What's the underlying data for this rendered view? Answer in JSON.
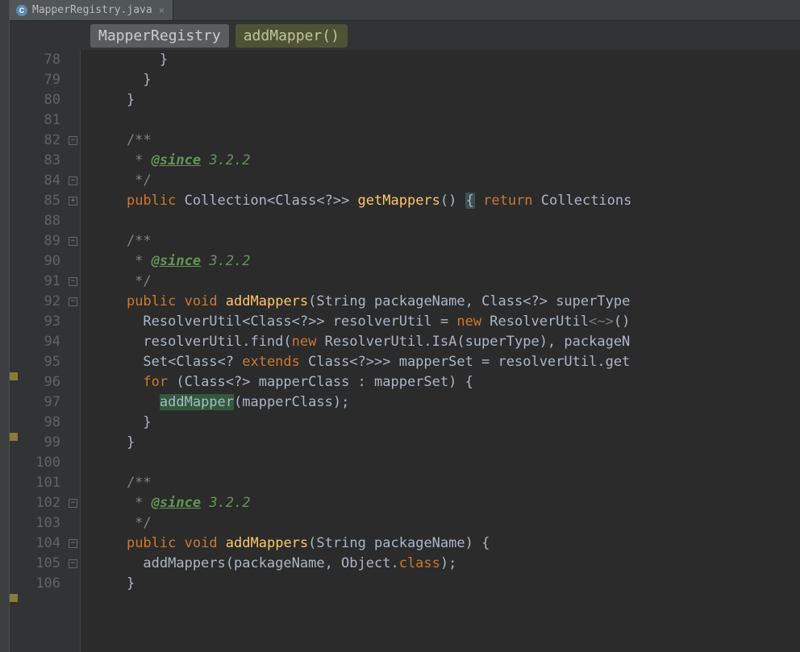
{
  "tab": {
    "filename": "MapperRegistry.java",
    "close_glyph": "×"
  },
  "breadcrumb": {
    "class": "MapperRegistry",
    "method": "addMapper()"
  },
  "lines": {
    "l78": "78",
    "l79": "79",
    "l80": "80",
    "l81": "81",
    "l82": "82",
    "l83": "83",
    "l84": "84",
    "l85": "85",
    "l88": "88",
    "l89": "89",
    "l90": "90",
    "l91": "91",
    "l92": "92",
    "l93": "93",
    "l94": "94",
    "l95": "95",
    "l96": "96",
    "l97": "97",
    "l98": "98",
    "l99": "99",
    "l100": "100",
    "l101": "101",
    "l102": "102",
    "l103": "103",
    "l104": "104",
    "l105": "105",
    "l106": "106"
  },
  "code": {
    "c78": "        }",
    "c79": "      }",
    "c80": "    }",
    "c81": "",
    "c82_open": "    /**",
    "c82_star": "     * ",
    "c82_tag": "@since",
    "c82_val": " 3.2.2",
    "c82_close": "     */",
    "c85_public": "public",
    "c85_sig1": " Collection<Class<?>> ",
    "c85_method": "getMappers",
    "c85_sig2": "() ",
    "c85_return": "return",
    "c85_tail": " Collections",
    "c88": "",
    "c92_public": "public",
    "c92_void": " void ",
    "c92_method": "addMappers",
    "c92_sig": "(String packageName, Class<?> superType",
    "c93_a": "      ResolverUtil<Class<?>> resolverUtil = ",
    "c93_new": "new",
    "c93_b": " ResolverUtil",
    "c93_diamond": "<~>",
    "c93_c": "()",
    "c94_a": "      resolverUtil.find(",
    "c94_new": "new",
    "c94_b": " ResolverUtil.IsA(superType), packageN",
    "c95_a": "      Set<Class<? ",
    "c95_ext": "extends",
    "c95_b": " Class<?>>> mapperSet = resolverUtil.get",
    "c96_for": "for",
    "c96_a": " (Class<?> mapperClass : mapperSet) {",
    "c97_call": "addMapper",
    "c97_tail": "(mapperClass);",
    "c98": "      }",
    "c99": "    }",
    "c100": "",
    "c104_public": "public",
    "c104_void": " void ",
    "c104_method": "addMappers",
    "c104_sig": "(String packageName) {",
    "c105_a": "      addMappers(packageName, Object.",
    "c105_field": "class",
    "c105_b": ");",
    "c106": "    }"
  }
}
